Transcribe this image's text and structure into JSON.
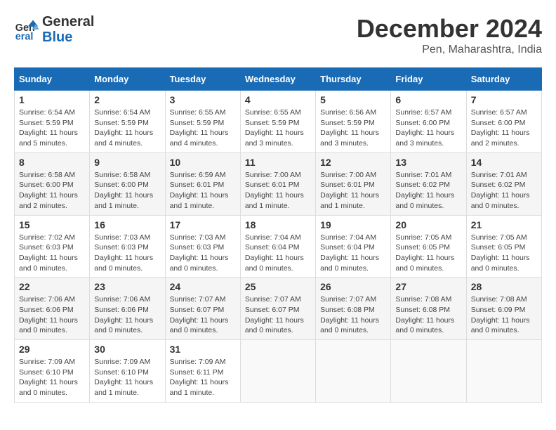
{
  "header": {
    "logo_line1": "General",
    "logo_line2": "Blue",
    "month": "December 2024",
    "location": "Pen, Maharashtra, India"
  },
  "days_of_week": [
    "Sunday",
    "Monday",
    "Tuesday",
    "Wednesday",
    "Thursday",
    "Friday",
    "Saturday"
  ],
  "weeks": [
    [
      {
        "day": 1,
        "sunrise": "6:54 AM",
        "sunset": "5:59 PM",
        "daylight": "11 hours and 5 minutes."
      },
      {
        "day": 2,
        "sunrise": "6:54 AM",
        "sunset": "5:59 PM",
        "daylight": "11 hours and 4 minutes."
      },
      {
        "day": 3,
        "sunrise": "6:55 AM",
        "sunset": "5:59 PM",
        "daylight": "11 hours and 4 minutes."
      },
      {
        "day": 4,
        "sunrise": "6:55 AM",
        "sunset": "5:59 PM",
        "daylight": "11 hours and 3 minutes."
      },
      {
        "day": 5,
        "sunrise": "6:56 AM",
        "sunset": "5:59 PM",
        "daylight": "11 hours and 3 minutes."
      },
      {
        "day": 6,
        "sunrise": "6:57 AM",
        "sunset": "6:00 PM",
        "daylight": "11 hours and 3 minutes."
      },
      {
        "day": 7,
        "sunrise": "6:57 AM",
        "sunset": "6:00 PM",
        "daylight": "11 hours and 2 minutes."
      }
    ],
    [
      {
        "day": 8,
        "sunrise": "6:58 AM",
        "sunset": "6:00 PM",
        "daylight": "11 hours and 2 minutes."
      },
      {
        "day": 9,
        "sunrise": "6:58 AM",
        "sunset": "6:00 PM",
        "daylight": "11 hours and 1 minute."
      },
      {
        "day": 10,
        "sunrise": "6:59 AM",
        "sunset": "6:01 PM",
        "daylight": "11 hours and 1 minute."
      },
      {
        "day": 11,
        "sunrise": "7:00 AM",
        "sunset": "6:01 PM",
        "daylight": "11 hours and 1 minute."
      },
      {
        "day": 12,
        "sunrise": "7:00 AM",
        "sunset": "6:01 PM",
        "daylight": "11 hours and 1 minute."
      },
      {
        "day": 13,
        "sunrise": "7:01 AM",
        "sunset": "6:02 PM",
        "daylight": "11 hours and 0 minutes."
      },
      {
        "day": 14,
        "sunrise": "7:01 AM",
        "sunset": "6:02 PM",
        "daylight": "11 hours and 0 minutes."
      }
    ],
    [
      {
        "day": 15,
        "sunrise": "7:02 AM",
        "sunset": "6:03 PM",
        "daylight": "11 hours and 0 minutes."
      },
      {
        "day": 16,
        "sunrise": "7:03 AM",
        "sunset": "6:03 PM",
        "daylight": "11 hours and 0 minutes."
      },
      {
        "day": 17,
        "sunrise": "7:03 AM",
        "sunset": "6:03 PM",
        "daylight": "11 hours and 0 minutes."
      },
      {
        "day": 18,
        "sunrise": "7:04 AM",
        "sunset": "6:04 PM",
        "daylight": "11 hours and 0 minutes."
      },
      {
        "day": 19,
        "sunrise": "7:04 AM",
        "sunset": "6:04 PM",
        "daylight": "11 hours and 0 minutes."
      },
      {
        "day": 20,
        "sunrise": "7:05 AM",
        "sunset": "6:05 PM",
        "daylight": "11 hours and 0 minutes."
      },
      {
        "day": 21,
        "sunrise": "7:05 AM",
        "sunset": "6:05 PM",
        "daylight": "11 hours and 0 minutes."
      }
    ],
    [
      {
        "day": 22,
        "sunrise": "7:06 AM",
        "sunset": "6:06 PM",
        "daylight": "11 hours and 0 minutes."
      },
      {
        "day": 23,
        "sunrise": "7:06 AM",
        "sunset": "6:06 PM",
        "daylight": "11 hours and 0 minutes."
      },
      {
        "day": 24,
        "sunrise": "7:07 AM",
        "sunset": "6:07 PM",
        "daylight": "11 hours and 0 minutes."
      },
      {
        "day": 25,
        "sunrise": "7:07 AM",
        "sunset": "6:07 PM",
        "daylight": "11 hours and 0 minutes."
      },
      {
        "day": 26,
        "sunrise": "7:07 AM",
        "sunset": "6:08 PM",
        "daylight": "11 hours and 0 minutes."
      },
      {
        "day": 27,
        "sunrise": "7:08 AM",
        "sunset": "6:08 PM",
        "daylight": "11 hours and 0 minutes."
      },
      {
        "day": 28,
        "sunrise": "7:08 AM",
        "sunset": "6:09 PM",
        "daylight": "11 hours and 0 minutes."
      }
    ],
    [
      {
        "day": 29,
        "sunrise": "7:09 AM",
        "sunset": "6:10 PM",
        "daylight": "11 hours and 0 minutes."
      },
      {
        "day": 30,
        "sunrise": "7:09 AM",
        "sunset": "6:10 PM",
        "daylight": "11 hours and 1 minute."
      },
      {
        "day": 31,
        "sunrise": "7:09 AM",
        "sunset": "6:11 PM",
        "daylight": "11 hours and 1 minute."
      },
      null,
      null,
      null,
      null
    ]
  ]
}
